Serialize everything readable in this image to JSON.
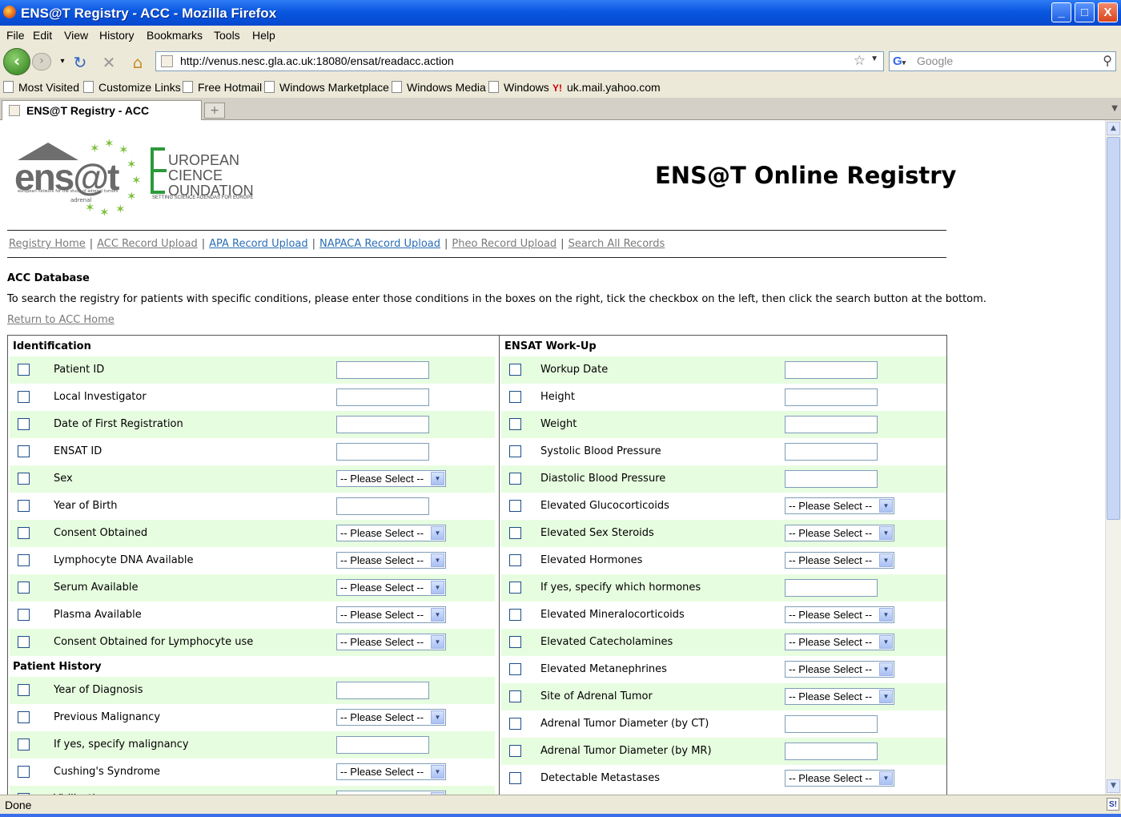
{
  "window": {
    "title": "ENS@T Registry - ACC - Mozilla Firefox",
    "min": "_",
    "max": "□",
    "close": "X"
  },
  "menu": [
    "File",
    "Edit",
    "View",
    "History",
    "Bookmarks",
    "Tools",
    "Help"
  ],
  "nav": {
    "url": "http://venus.nesc.gla.ac.uk:18080/ensat/readacc.action",
    "search_placeholder": "Google"
  },
  "bookmarks": [
    "Most Visited",
    "Customize Links",
    "Free Hotmail",
    "Windows Marketplace",
    "Windows Media",
    "Windows",
    "uk.mail.yahoo.com"
  ],
  "tab": {
    "label": "ENS@T Registry - ACC"
  },
  "status": "Done",
  "page": {
    "ensat_logo": {
      "word": "ens@t",
      "tagline": "european network for the study of adrenal tumors",
      "adrenal": "adrenal"
    },
    "esf_logo": {
      "lines": [
        "UROPEAN",
        "CIENCE",
        "OUNDATION"
      ],
      "tagline": "SETTING SCIENCE AGENDAS FOR EUROPE"
    },
    "site_title": "ENS@T Online Registry",
    "subnav": [
      {
        "label": "Registry Home",
        "color": "grey"
      },
      {
        "label": "ACC Record Upload",
        "color": "grey"
      },
      {
        "label": "APA Record Upload",
        "color": "blue"
      },
      {
        "label": "NAPACA Record Upload",
        "color": "blue"
      },
      {
        "label": "Pheo Record Upload",
        "color": "grey"
      },
      {
        "label": "Search All Records",
        "color": "grey"
      }
    ],
    "db_title": "ACC Database",
    "instructions": "To search the registry for patients with specific conditions, please enter those conditions in the boxes on the right, tick the checkbox on the left, then click the search button at the bottom.",
    "return_link": "Return to ACC Home",
    "select_default": "-- Please Select --",
    "left_sections": [
      {
        "heading": "Identification",
        "rows": [
          {
            "label": "Patient ID",
            "type": "text"
          },
          {
            "label": "Local Investigator",
            "type": "text"
          },
          {
            "label": "Date of First Registration",
            "type": "text"
          },
          {
            "label": "ENSAT ID",
            "type": "text"
          },
          {
            "label": "Sex",
            "type": "select"
          },
          {
            "label": "Year of Birth",
            "type": "text"
          },
          {
            "label": "Consent Obtained",
            "type": "select"
          },
          {
            "label": "Lymphocyte DNA Available",
            "type": "select"
          },
          {
            "label": "Serum Available",
            "type": "select"
          },
          {
            "label": "Plasma Available",
            "type": "select"
          },
          {
            "label": "Consent Obtained for Lymphocyte use",
            "type": "select"
          }
        ]
      },
      {
        "heading": "Patient History",
        "rows": [
          {
            "label": "Year of Diagnosis",
            "type": "text"
          },
          {
            "label": "Previous Malignancy",
            "type": "select"
          },
          {
            "label": "If yes, specify malignancy",
            "type": "text"
          },
          {
            "label": "Cushing's Syndrome",
            "type": "select"
          },
          {
            "label": "Virilization",
            "type": "select"
          }
        ]
      }
    ],
    "right_sections": [
      {
        "heading": "ENSAT Work-Up",
        "rows": [
          {
            "label": "Workup Date",
            "type": "text"
          },
          {
            "label": "Height",
            "type": "text"
          },
          {
            "label": "Weight",
            "type": "text"
          },
          {
            "label": "Systolic Blood Pressure",
            "type": "text"
          },
          {
            "label": "Diastolic Blood Pressure",
            "type": "text"
          },
          {
            "label": "Elevated Glucocorticoids",
            "type": "select"
          },
          {
            "label": "Elevated Sex Steroids",
            "type": "select"
          },
          {
            "label": "Elevated Hormones",
            "type": "select"
          },
          {
            "label": "If yes, specify which hormones",
            "type": "text"
          },
          {
            "label": "Elevated Mineralocorticoids",
            "type": "select"
          },
          {
            "label": "Elevated Catecholamines",
            "type": "select"
          },
          {
            "label": "Elevated Metanephrines",
            "type": "select"
          },
          {
            "label": "Site of Adrenal Tumor",
            "type": "select"
          },
          {
            "label": "Adrenal Tumor Diameter (by CT)",
            "type": "text"
          },
          {
            "label": "Adrenal Tumor Diameter (by MR)",
            "type": "text"
          },
          {
            "label": "Detectable Metastases",
            "type": "select"
          }
        ]
      }
    ]
  }
}
